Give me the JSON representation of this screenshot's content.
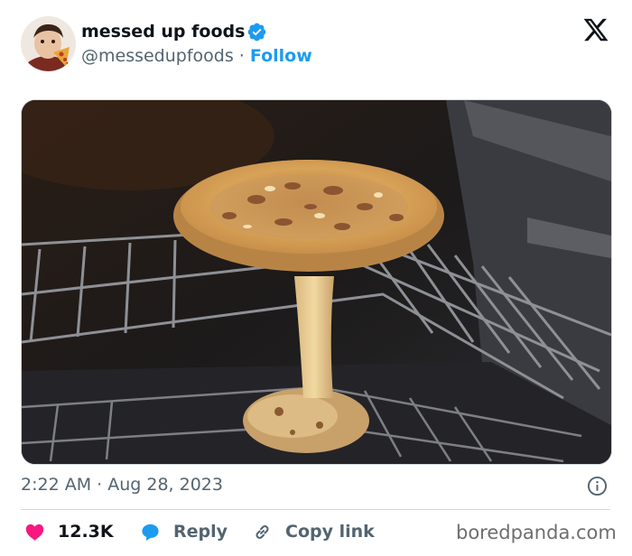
{
  "tweet": {
    "author": {
      "display_name": "messed up foods",
      "handle": "@messedupfoods",
      "separator": " · ",
      "follow_label": "Follow",
      "verified": true,
      "avatar_icon": "avatar-child-eating-pizza"
    },
    "brand_icon": "x-logo-icon",
    "media": {
      "image_kind": "photo",
      "icon": "pizza-mushroom-oven-photo"
    },
    "timestamp": {
      "time": "2:22 AM",
      "separator": " · ",
      "date": "Aug 28, 2023"
    },
    "actions": {
      "like_count": "12.3K",
      "reply_label": "Reply",
      "copy_link_label": "Copy link"
    },
    "watermark": "boredpanda.com"
  },
  "colors": {
    "accent_blue": "#1d9bf0",
    "like_red": "#f91880",
    "text_primary": "#0f1419",
    "text_secondary": "#536471",
    "divider": "#cfd9de"
  }
}
